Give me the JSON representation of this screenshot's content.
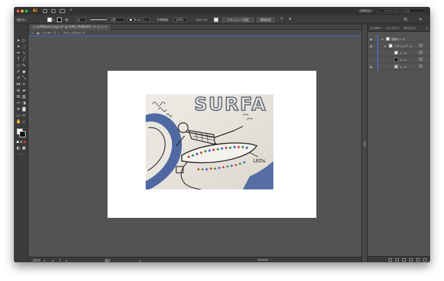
{
  "menubar": {
    "app_name": "Ai",
    "right_label": "初期設定",
    "search_placeholder": "Adobe Stock を検索"
  },
  "controlbar": {
    "selection_label": "選択なし",
    "stroke_label": "線:",
    "stroke_value": "pt",
    "stroke_style": "均等",
    "brush": "Touch C...",
    "opacity_label": "不透明度:",
    "opacity_value": "100%",
    "style_label": "スタイル:",
    "doc_settings": "ドキュメント設定",
    "preferences": "環境設定"
  },
  "document": {
    "tab_title": "surfAIboard_logo.ai* @ 100% (RGB/GPU プレビュー)",
    "breadcrumb_layer": "レイヤー 1",
    "breadcrumb_group": "クリップグループ"
  },
  "status": {
    "zoom": "100%",
    "page": "1",
    "tool": "選択"
  },
  "panel": {
    "tabs": [
      "レイヤー",
      "ライブラリ",
      "プロパティ"
    ],
    "layers": [
      {
        "name": "画像モード"
      },
      {
        "name": "<クリップ...>"
      },
      {
        "name": "<...>"
      },
      {
        "name": "<...>"
      },
      {
        "name": "<...>"
      }
    ]
  },
  "artwork": {
    "headline": "SURFA",
    "annotation": "LEDs"
  },
  "colors": {
    "accent": "#2f6fd6",
    "close": "#ff5f57",
    "minimize": "#febc2e",
    "zoom": "#28c840"
  }
}
